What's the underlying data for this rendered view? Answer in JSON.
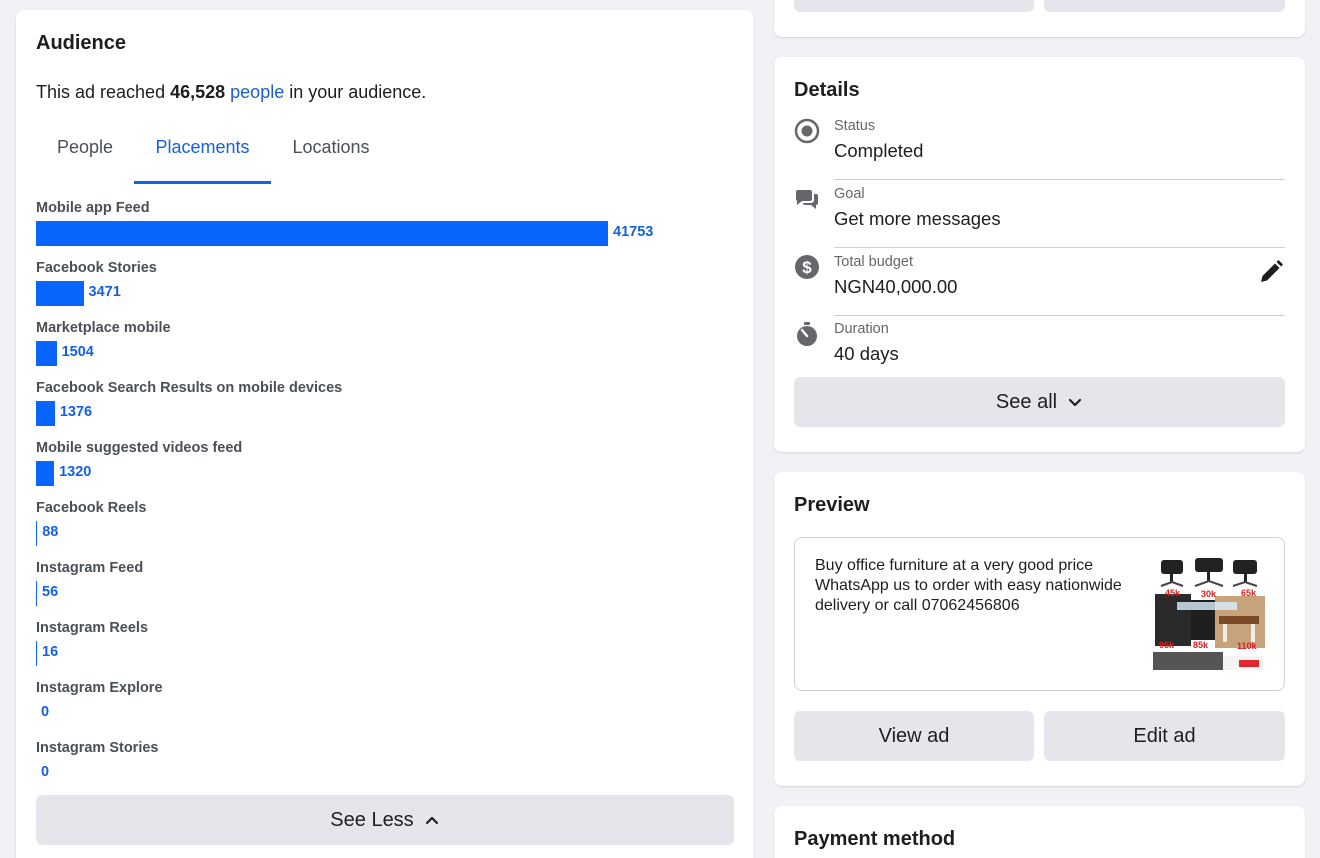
{
  "audience": {
    "title": "Audience",
    "reach_prefix": "This ad reached ",
    "reach_count": "46,528",
    "reach_link": "people",
    "reach_suffix": " in your audience.",
    "tabs": [
      {
        "label": "People",
        "active": false
      },
      {
        "label": "Placements",
        "active": true
      },
      {
        "label": "Locations",
        "active": false
      }
    ],
    "placements": [
      {
        "label": "Mobile app Feed",
        "value": 41753
      },
      {
        "label": "Facebook Stories",
        "value": 3471
      },
      {
        "label": "Marketplace mobile",
        "value": 1504
      },
      {
        "label": "Facebook Search Results on mobile devices",
        "value": 1376
      },
      {
        "label": "Mobile suggested videos feed",
        "value": 1320
      },
      {
        "label": "Facebook Reels",
        "value": 88
      },
      {
        "label": "Instagram Feed",
        "value": 56
      },
      {
        "label": "Instagram Reels",
        "value": 16
      },
      {
        "label": "Instagram Explore",
        "value": 0
      },
      {
        "label": "Instagram Stories",
        "value": 0
      }
    ],
    "bar_color": "#0866ff",
    "see_less_label": "See Less"
  },
  "details": {
    "title": "Details",
    "rows": [
      {
        "icon": "status-radio-icon",
        "label": "Status",
        "value": "Completed"
      },
      {
        "icon": "chat-bubbles-icon",
        "label": "Goal",
        "value": "Get more messages"
      },
      {
        "icon": "dollar-circle-icon",
        "label": "Total budget",
        "value": "NGN40,000.00"
      },
      {
        "icon": "stopwatch-icon",
        "label": "Duration",
        "value": "40 days"
      }
    ],
    "see_all_label": "See all"
  },
  "preview": {
    "title": "Preview",
    "text": "Buy office furniture at a very good price WhatsApp us to order with easy nationwide delivery or call 07062456806",
    "view_ad_label": "View ad",
    "edit_ad_label": "Edit ad"
  },
  "payment": {
    "title": "Payment method"
  }
}
